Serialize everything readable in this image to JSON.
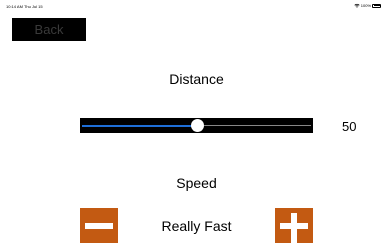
{
  "status_bar": {
    "time": "10:14 AM  Thu Jul 15",
    "battery": "100%",
    "wifi_icon": "wifi-icon",
    "battery_icon": "battery-icon"
  },
  "nav": {
    "back_label": "Back"
  },
  "distance": {
    "label": "Distance",
    "value": "50",
    "fraction": 0.5
  },
  "speed": {
    "label": "Speed",
    "value": "Really Fast",
    "decrease_icon": "minus-icon",
    "increase_icon": "plus-icon"
  },
  "colors": {
    "slider_fill": "#1e6fd9",
    "step_button": "#c35a12",
    "back_button_bg": "#000000"
  }
}
